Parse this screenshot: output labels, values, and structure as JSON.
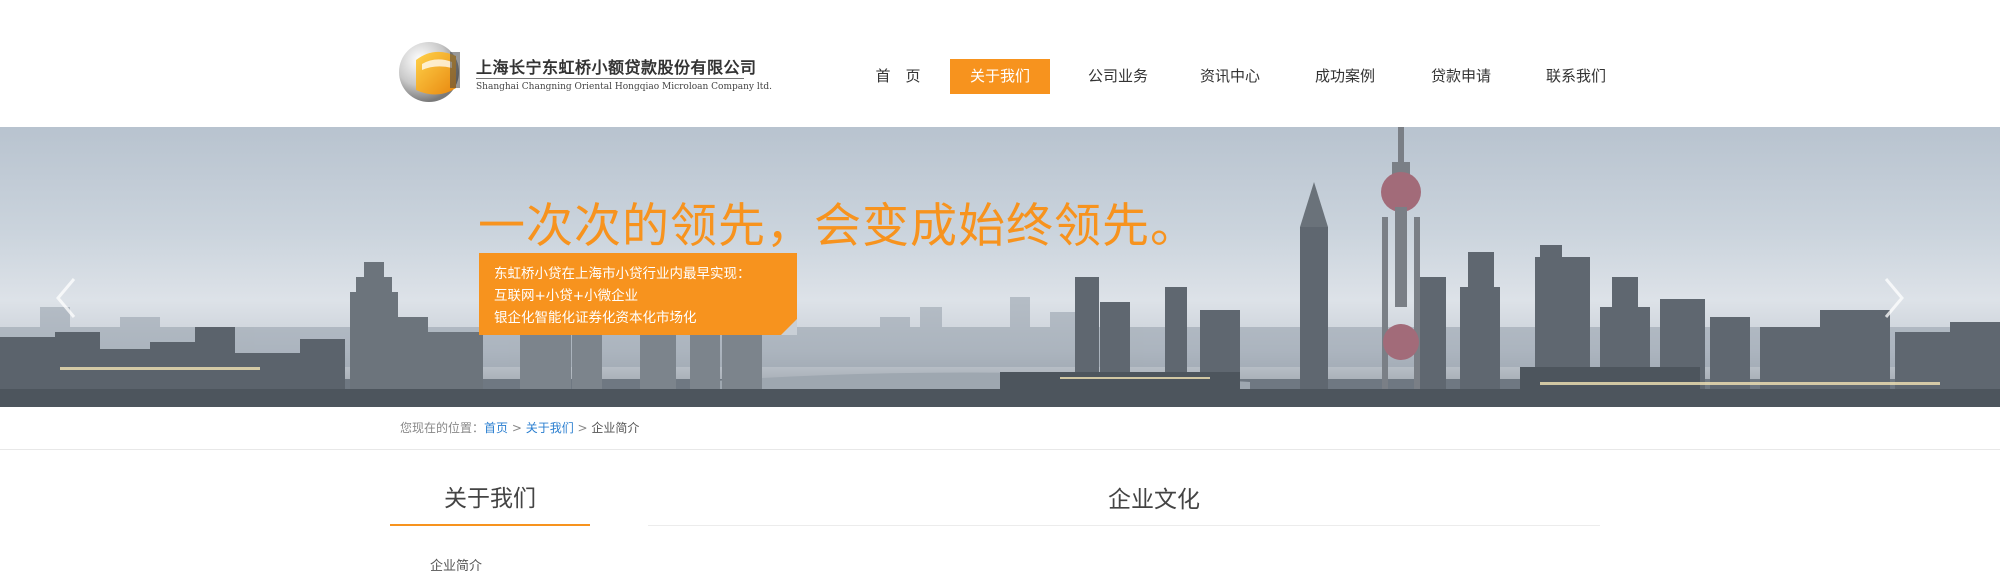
{
  "site": {
    "name_cn": "上海长宁东虹桥小额贷款股份有限公司",
    "name_en": "Shanghai Changning Oriental Hongqiao Microloan Company ltd."
  },
  "nav": {
    "items": [
      {
        "label": "首　页",
        "active": false
      },
      {
        "label": "关于我们",
        "active": true
      },
      {
        "label": "公司业务",
        "active": false
      },
      {
        "label": "资讯中心",
        "active": false
      },
      {
        "label": "成功案例",
        "active": false
      },
      {
        "label": "贷款申请",
        "active": false
      },
      {
        "label": "联系我们",
        "active": false
      }
    ]
  },
  "banner": {
    "headline": "一次次的领先，会变成始终领先。",
    "callout_lines": [
      "东虹桥小贷在上海市小贷行业内最早实现：",
      "互联网+小贷+小微企业",
      "银企化智能化证券化资本化市场化"
    ],
    "prev_icon": "chevron-left-icon",
    "next_icon": "chevron-right-icon"
  },
  "breadcrumb": {
    "prefix": "您现在的位置：",
    "home": "首页",
    "sep1": " > ",
    "section": "关于我们",
    "sep2": " > ",
    "current": "企业简介"
  },
  "sidebar": {
    "title": "关于我们",
    "first_item": "企业简介"
  },
  "main": {
    "title": "企业文化"
  },
  "colors": {
    "accent": "#f7931e",
    "link": "#2b7fd0"
  }
}
